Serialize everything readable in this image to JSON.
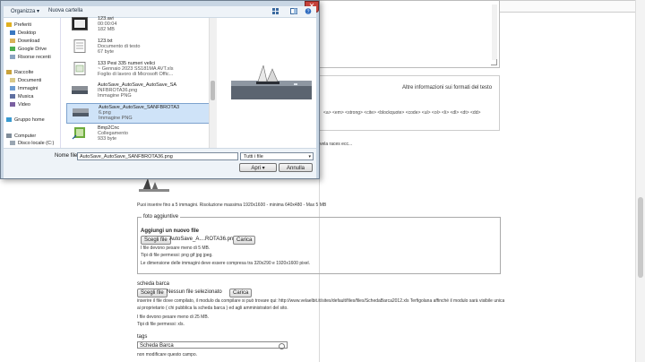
{
  "dialog": {
    "toolbar": {
      "organize": "Organizza ▾",
      "new_folder": "Nuova cartella"
    },
    "nav": [
      {
        "label": "Preferiti",
        "icon": "star-icon"
      },
      {
        "label": "Desktop",
        "icon": "desktop-icon"
      },
      {
        "label": "Download",
        "icon": "download-folder-icon"
      },
      {
        "label": "Google Drive",
        "icon": "drive-icon"
      },
      {
        "label": "Risorse recenti",
        "icon": "recent-icon"
      },
      {
        "label": "Raccolte",
        "icon": "library-icon"
      },
      {
        "label": "Documenti",
        "icon": "documents-icon"
      },
      {
        "label": "Immagini",
        "icon": "images-icon"
      },
      {
        "label": "Musica",
        "icon": "music-icon"
      },
      {
        "label": "Video",
        "icon": "video-icon"
      },
      {
        "label": "Gruppo home",
        "icon": "homegroup-icon"
      },
      {
        "label": "Computer",
        "icon": "computer-icon"
      },
      {
        "label": "Disco locale (C:)",
        "icon": "disk-icon"
      }
    ],
    "files": [
      {
        "name": "123.avi",
        "line2": "00:00:04",
        "line3": "182 MB"
      },
      {
        "name": "123.txt",
        "line2": "Documento di testo",
        "line3": "67 byte"
      },
      {
        "name": "133 Pesi        335 numeri velici",
        "line2": "~ Gennaio  2023  SS181MA AVT.xls",
        "line3": "Foglio di lavoro di Microsoft Offic..."
      },
      {
        "name": "AutoSave_AutoSave_AutoSave_SA",
        "line2": "INFBROTA36.png",
        "line3": "Immagine PNG"
      },
      {
        "name": "AutoSave_AutoSave_SANFBROTA3",
        "line2": "6.png",
        "line3": "Immagine PNG"
      },
      {
        "name": "Bmp2Cnc",
        "line2": "Collegamento",
        "line3": "933 byte"
      }
    ],
    "filename_label": "Nome file:",
    "filename_value": "AutoSave_AutoSave_SANFBROTA36.png",
    "filetype_value": "Tutti i file",
    "open_label": "Apri",
    "cancel_label": "Annulla"
  },
  "page": {
    "formats_link": "Altre informazioni sui formati del testo",
    "allowed_tags": "<a> <em> <strong> <cite> <blockquote> <code> <ul> <ol> <li> <dl> <dt> <dd>",
    "sail_text": "vela races ecc...",
    "photo_hint": "Puoi inserire fino a 5 immagini. Risoluzione massima 1920x1600 - minima 640x480 - Max 5 MB",
    "photos_legend": "foto aggiuntive",
    "add_file_title": "Aggiungi un nuovo file",
    "choose_file_btn": "Scegli file",
    "chosen_file": "AutoSave_A....ROTA36.png",
    "upload_btn": "Carica",
    "size_note": "I file devono pesare meno di 5 MB.",
    "types_note": "Tipi di file permessi: png gif jpg jpeg.",
    "dimension_note": "Le dimensione delle immagini deve essere compresa tra 320x290 e 1920x1600 pixel.",
    "sheet_title": "scheda barca",
    "sheet_choose_btn": "Scegli file",
    "sheet_no_file": "Nessun file selezionato",
    "sheet_upload_btn": "Carica",
    "sheet_note1": "inserire il file dove compilato, il modulo da compilare si può trovare qui: http://www.velaelbit.it/sites/default/files/files/SchedaBarca2012.xls Terfigolana affinché il modulo sarà visibile unicamente",
    "sheet_note2": "ai proprietario ( chi pubblica la scheda barca ) ed agli amministratori del sito.",
    "sheet_note3": "I file devono pesare meno di 25 MB.",
    "sheet_note4": "Tipi di file permessi: xls.",
    "tags_title": "tags",
    "tags_value": "Scheda Barca",
    "tags_note": "non modificare questo campo."
  }
}
